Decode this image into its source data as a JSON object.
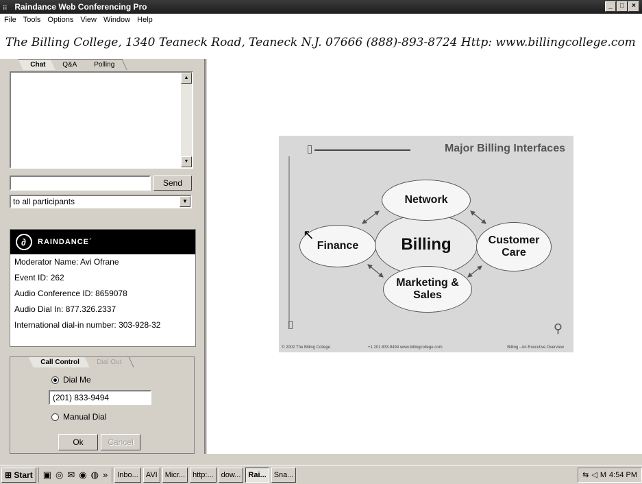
{
  "window": {
    "title": "Raindance Web Conferencing Pro",
    "buttons": [
      "_",
      "□",
      "×"
    ]
  },
  "menu": [
    "File",
    "Tools",
    "Options",
    "View",
    "Window",
    "Help"
  ],
  "banner": "The Billing College, 1340 Teaneck Road, Teaneck N.J. 07666 (888)-893-8724 Http: www.billingcollege.com",
  "chat": {
    "tabs": [
      "Chat",
      "Q&A",
      "Polling"
    ],
    "input_value": "",
    "send_label": "Send",
    "recipient": "to all participants"
  },
  "info": {
    "logo_text": "RAINDANCE´",
    "lines": [
      "Moderator Name:  Avi  Ofrane",
      "Event ID: 262",
      "Audio Conference ID: 8659078",
      "Audio Dial In: 877.326.2337",
      "International dial-in number: 303-928-32"
    ]
  },
  "call_control": {
    "tabs": [
      "Call Control",
      "Dial Out"
    ],
    "dial_me_label": "Dial Me",
    "phone_value": "(201) 833-9494",
    "manual_dial_label": "Manual Dial",
    "ok_label": "Ok",
    "cancel_label": "Cancel",
    "selected": "Dial Me"
  },
  "slide": {
    "title": "Major Billing Interfaces",
    "nodes": {
      "center": "Billing",
      "top": "Network",
      "left": "Finance",
      "right": "Customer Care",
      "bottom": "Marketing & Sales"
    },
    "footer_left": "© 2002  The Billing College",
    "footer_mid": "+1.201.833.9494   www.billingcollege.com",
    "footer_right": "Billing - An Executive Overview"
  },
  "taskbar": {
    "start_label": "Start",
    "tasks": [
      "Inbo...",
      "AVI",
      "Micr...",
      "http:...",
      "dow...",
      "Rai...",
      "Sna..."
    ],
    "active_task": "Rai...",
    "clock": "4:54 PM"
  },
  "colors": {
    "titlebar": "#1e1e1e",
    "panel": "#d4d0c8",
    "slide_bg": "#d8d8d8"
  }
}
